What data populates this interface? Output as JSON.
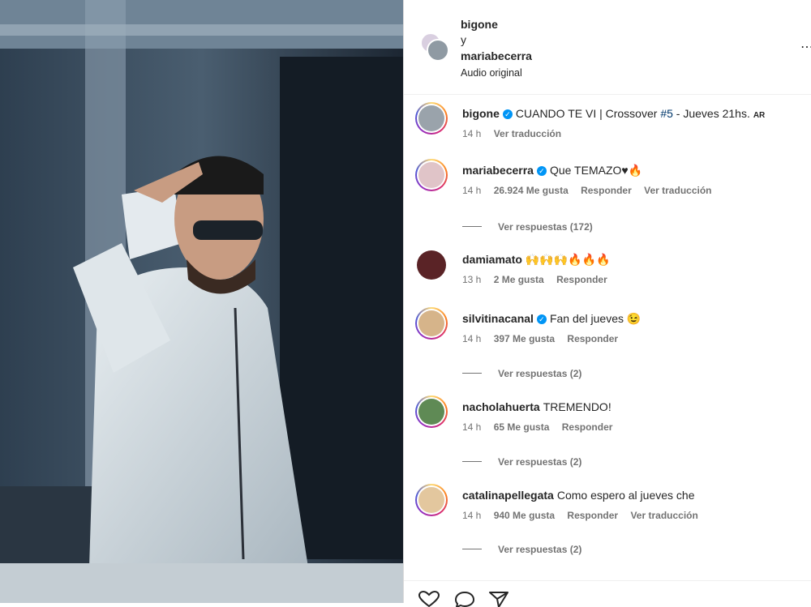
{
  "header": {
    "user1": "bigone",
    "conjunction": "y",
    "user2": "mariabecerra",
    "audio": "Audio original",
    "more": "⋯"
  },
  "caption": {
    "user": "bigone",
    "text_prefix": "CUANDO TE VI | Crossover ",
    "hashtag": "#5",
    "text_suffix": " - Jueves 21hs.",
    "lang": "AR",
    "time": "14 h",
    "translate": "Ver traducción"
  },
  "comments": [
    {
      "user": "mariabecerra",
      "verified": true,
      "text": "Que TEMAZO♥🔥",
      "time": "14 h",
      "likes": "26.924 Me gusta",
      "reply": "Responder",
      "translate": "Ver traducción",
      "replies": "Ver respuestas (172)"
    },
    {
      "user": "damiamato",
      "verified": false,
      "text": "🙌🙌🙌🔥🔥🔥",
      "time": "13 h",
      "likes": "2 Me gusta",
      "reply": "Responder",
      "translate": "",
      "replies": ""
    },
    {
      "user": "silvitinacanal",
      "verified": true,
      "text": "Fan del jueves 😉",
      "time": "14 h",
      "likes": "397 Me gusta",
      "reply": "Responder",
      "translate": "",
      "replies": "Ver respuestas (2)"
    },
    {
      "user": "nacholahuerta",
      "verified": false,
      "text": "TREMENDO!",
      "time": "14 h",
      "likes": "65 Me gusta",
      "reply": "Responder",
      "translate": "",
      "replies": "Ver respuestas (2)"
    },
    {
      "user": "catalinapellegata",
      "verified": false,
      "text": "Como espero al jueves che",
      "time": "14 h",
      "likes": "940 Me gusta",
      "reply": "Responder",
      "translate": "Ver traducción",
      "replies": "Ver respuestas (2)"
    }
  ],
  "colors": {
    "verified": "#0095f6",
    "hashtag": "#00376b",
    "muted": "#737373",
    "text": "#262626"
  }
}
